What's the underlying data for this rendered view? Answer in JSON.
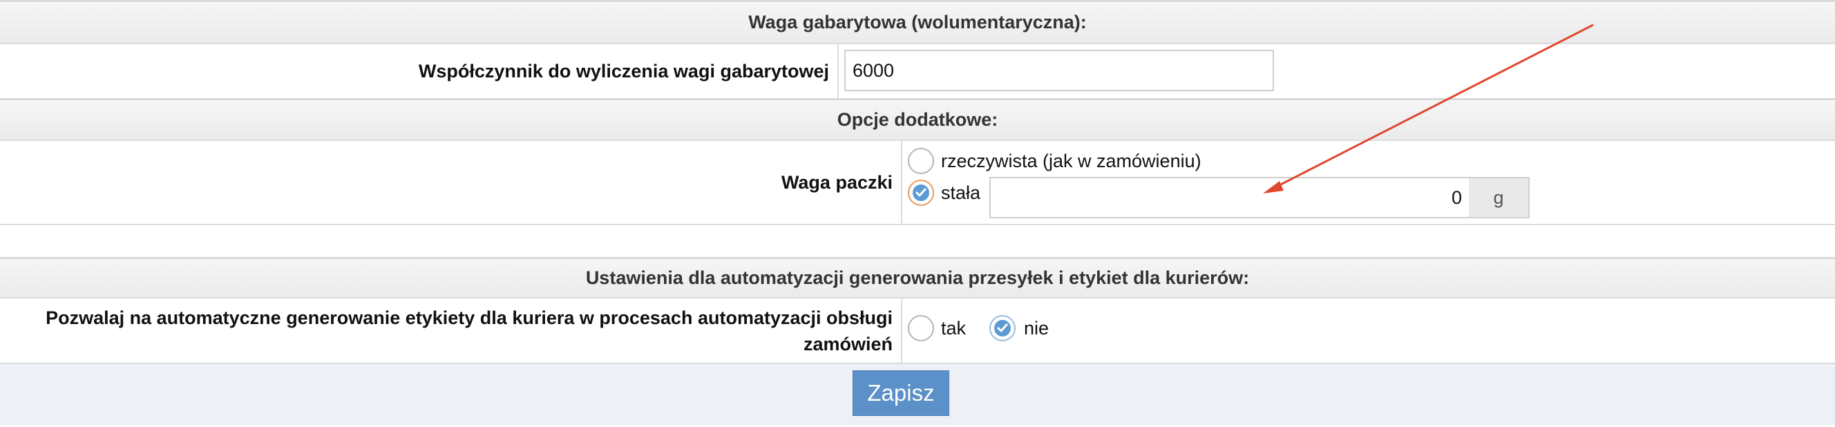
{
  "sections": {
    "dimensional_weight": {
      "header": "Waga gabarytowa (wolumentaryczna):"
    },
    "additional_options": {
      "header": "Opcje dodatkowe:"
    },
    "automation": {
      "header": "Ustawienia dla automatyzacji generowania przesyłek i etykiet dla kurierów:"
    }
  },
  "fields": {
    "coefficient": {
      "label": "Współczynnik do wyliczenia wagi gabarytowej",
      "value": "6000"
    },
    "package_weight": {
      "label": "Waga paczki",
      "option_real": "rzeczywista (jak w zamówieniu)",
      "option_fixed": "stała",
      "selected": "stała",
      "value": "0",
      "unit": "g"
    },
    "auto_label": {
      "label_line1": "Pozwalaj na automatyczne generowanie etykiety dla kuriera w procesach automatyzacji obsługi",
      "label_line2": "zamówień",
      "option_yes": "tak",
      "option_no": "nie",
      "selected": "nie"
    }
  },
  "actions": {
    "save_label": "Zapisz"
  },
  "colors": {
    "accent": "#5b9bd5",
    "button": "#5b90c8",
    "annotation_arrow": "#e0472f"
  }
}
